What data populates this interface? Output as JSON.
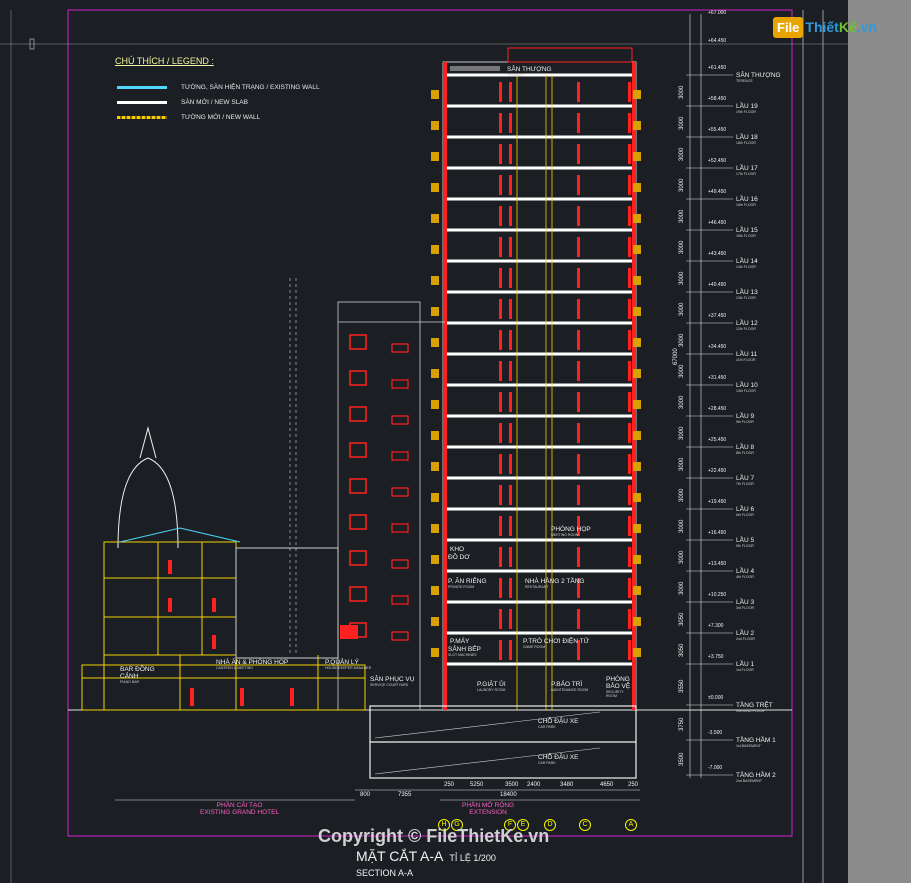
{
  "logo": {
    "box": "File",
    "text_a": "Thiết",
    "text_b": "Kế",
    "suffix": ".vn"
  },
  "copyright": "Copyright © FileThietKe.vn",
  "title": {
    "main": "MẶT CẮT A-A",
    "scale": "TỈ LỆ 1/200",
    "sub": "SECTION A-A"
  },
  "legend": {
    "title": "CHÚ THÍCH / LEGEND :",
    "items": [
      {
        "text": "TƯỜNG, SÀN HIỆN TRẠNG / EXISTING WALL",
        "color": "#4fd8ff"
      },
      {
        "text": "SÀN MỚI / NEW SLAB",
        "color": "#ffffff"
      },
      {
        "text": "TƯỜNG MỚI / NEW WALL",
        "color": "#f5d000"
      }
    ]
  },
  "floors": [
    {
      "name": "SÂN THƯỢNG",
      "sub": "TERRACE",
      "level": "+61.450"
    },
    {
      "name": "LẦU 19",
      "sub": "19th FLOOR",
      "level": "+58.450"
    },
    {
      "name": "LẦU 18",
      "sub": "18th FLOOR",
      "level": "+55.450"
    },
    {
      "name": "LẦU 17",
      "sub": "17th FLOOR",
      "level": "+52.450"
    },
    {
      "name": "LẦU 16",
      "sub": "16th FLOOR",
      "level": "+49.450"
    },
    {
      "name": "LẦU 15",
      "sub": "15th FLOOR",
      "level": "+46.450"
    },
    {
      "name": "LẦU 14",
      "sub": "14th FLOOR",
      "level": "+43.450"
    },
    {
      "name": "LẦU 13",
      "sub": "13th FLOOR",
      "level": "+40.450"
    },
    {
      "name": "LẦU 12",
      "sub": "12th FLOOR",
      "level": "+37.450"
    },
    {
      "name": "LẦU 11",
      "sub": "11th FLOOR",
      "level": "+34.450"
    },
    {
      "name": "LẦU 10",
      "sub": "10th FLOOR",
      "level": "+31.450"
    },
    {
      "name": "LẦU 9",
      "sub": "9th FLOOR",
      "level": "+28.450"
    },
    {
      "name": "LẦU 8",
      "sub": "8th FLOOR",
      "level": "+25.450"
    },
    {
      "name": "LẦU 7",
      "sub": "7th FLOOR",
      "level": "+22.450"
    },
    {
      "name": "LẦU 6",
      "sub": "6th FLOOR",
      "level": "+19.450"
    },
    {
      "name": "LẦU 5",
      "sub": "5th FLOOR",
      "level": "+16.450"
    },
    {
      "name": "LẦU 4",
      "sub": "4th FLOOR",
      "level": "+13.450"
    },
    {
      "name": "LẦU 3",
      "sub": "3rd FLOOR",
      "level": "+10.250"
    },
    {
      "name": "LẦU 2",
      "sub": "2nd FLOOR",
      "level": "+7.300"
    },
    {
      "name": "LẦU 1",
      "sub": "1st FLOOR",
      "level": "+3.750"
    },
    {
      "name": "TẦNG TRỆT",
      "sub": "GROUND FLOOR",
      "level": "±0.000"
    },
    {
      "name": "TẦNG HẦM 1",
      "sub": "1st BASEMENT",
      "level": "-3.500"
    },
    {
      "name": "TẦNG HẦM 2",
      "sub": "2nd BASEMENT",
      "level": "-7.000"
    }
  ],
  "top_level": "+67.000",
  "top_mark": "+64.450",
  "rooms": {
    "terrace": {
      "name": "SÂN THƯỢNG",
      "sub": "TERRACE"
    },
    "meeting": {
      "name": "PHÒNG HỌP",
      "sub": "MEETING ROOM"
    },
    "storage": {
      "name": "KHO",
      "sub": ""
    },
    "dirty": {
      "name": "ĐỒ DƠ",
      "sub": ""
    },
    "private": {
      "name": "P. ĂN RIÊNG",
      "sub": "PRIVATE ROOM"
    },
    "restaurant": {
      "name": "NHÀ HÀNG 2 TẦNG",
      "sub": "RESTAURANT"
    },
    "machine": {
      "name": "P.MÁY",
      "sub": ""
    },
    "hall": {
      "name": "SẢNH BẾP",
      "sub": "SLOT MACHINES"
    },
    "game": {
      "name": "P.TRÒ CHƠI ĐIỆN TỬ",
      "sub": "GAME ROOM"
    },
    "banquet": {
      "name": "NHÀ ĂN & PHÒNG HỌP",
      "sub": "CANTEEN & MEETING"
    },
    "manager": {
      "name": "P.QUẢN LÝ",
      "sub": "HOUSE KEEPER MANAGER"
    },
    "bar": {
      "name": "BAR ĐỒNG CẢNH",
      "sub": "PIANO BAR"
    },
    "service": {
      "name": "SÂN PHỤC VỤ",
      "sub": "SERVICE COURTYARD"
    },
    "laundry": {
      "name": "P.GIẶT ỦI",
      "sub": "LAUNDRY ROOM"
    },
    "maintenance": {
      "name": "P.BẢO TRÌ",
      "sub": "MAINTENANCE ROOM"
    },
    "security": {
      "name": "PHÒNG BẢO VỆ",
      "sub": "SECURITY ROOM"
    },
    "carpark1": {
      "name": "CHỖ ĐẬU XE",
      "sub": "CAR PARK"
    },
    "carpark2": {
      "name": "CHỖ ĐẬU XE",
      "sub": "CAR PARK"
    }
  },
  "floor_heights": [
    "3000",
    "3000",
    "3000",
    "3000",
    "3000",
    "3000",
    "3000",
    "3000",
    "3000",
    "3000",
    "3000",
    "3000",
    "3000",
    "3000",
    "3000",
    "3000",
    "3000",
    "3050",
    "3050",
    "3550",
    "3750",
    "3500",
    "3500"
  ],
  "total_height": "67000",
  "grid": {
    "bubbles": [
      "H",
      "G",
      "F",
      "E",
      "D",
      "C",
      "A"
    ],
    "spans": [
      "250",
      "5250",
      "3500",
      "2400",
      "3480",
      "4650",
      "250"
    ],
    "total": "18400",
    "left_spans": [
      "800",
      "7355"
    ]
  },
  "extents": {
    "existing": {
      "vn": "PHẦN CẢI TẠO",
      "en": "EXISTING GRAND HOTEL"
    },
    "extension": {
      "vn": "PHẦN MỞ RỘNG",
      "en": "EXTENSION"
    }
  }
}
